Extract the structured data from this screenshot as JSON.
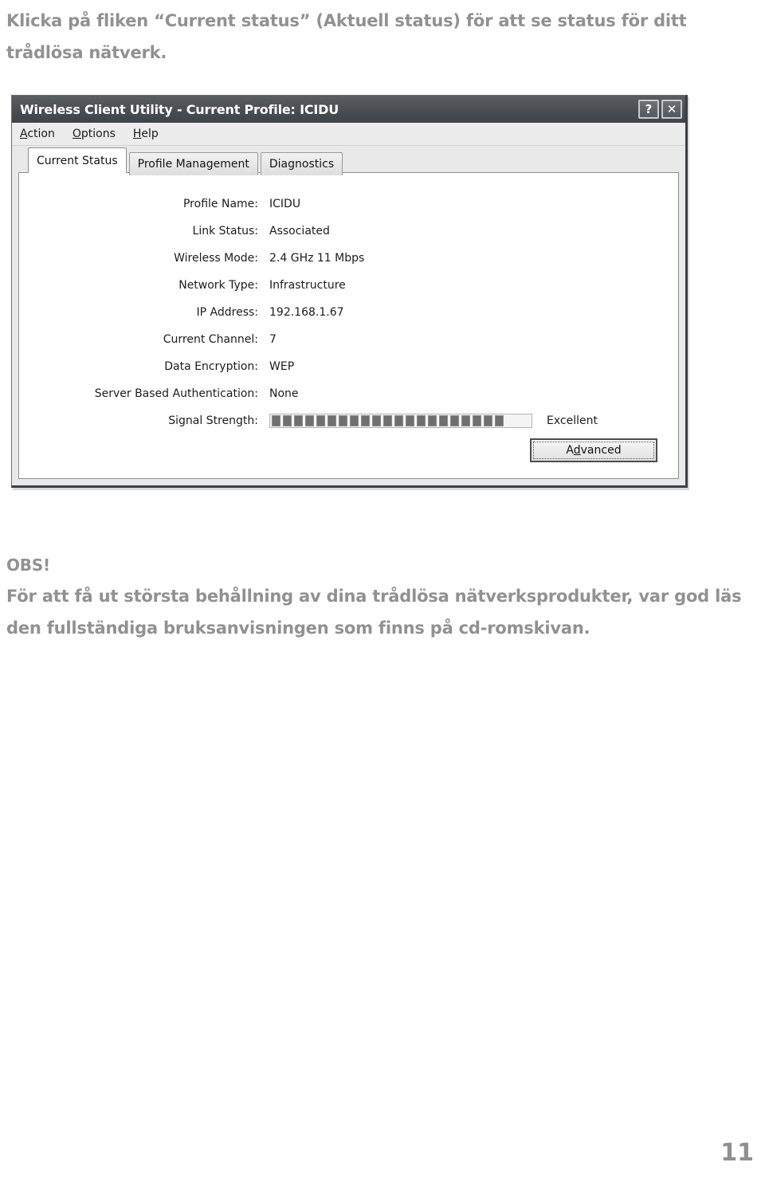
{
  "intro_text": "Klicka på fliken “Current status” (Aktuell status) för att se status för ditt trådlösa nätverk.",
  "dialog": {
    "titlebar": {
      "title": "Wireless Client Utility - Current Profile: ICIDU",
      "help_button": "?",
      "close_button": "✕"
    },
    "menubar": {
      "items": [
        {
          "accel": "A",
          "rest": "ction"
        },
        {
          "accel": "O",
          "rest": "ptions"
        },
        {
          "accel": "H",
          "rest": "elp"
        }
      ]
    },
    "tabs": [
      {
        "label": "Current Status",
        "active": true
      },
      {
        "label": "Profile Management",
        "active": false
      },
      {
        "label": "Diagnostics",
        "active": false
      }
    ],
    "fields": [
      {
        "label": "Profile Name:",
        "value": "ICIDU"
      },
      {
        "label": "Link Status:",
        "value": "Associated"
      },
      {
        "label": "Wireless Mode:",
        "value": "2.4 GHz 11 Mbps"
      },
      {
        "label": "Network Type:",
        "value": "Infrastructure"
      },
      {
        "label": "IP Address:",
        "value": "192.168.1.67"
      },
      {
        "label": "Current Channel:",
        "value": "7"
      },
      {
        "label": "Data Encryption:",
        "value": "WEP"
      },
      {
        "label": "Server Based Authentication:",
        "value": "None"
      }
    ],
    "signal": {
      "label": "Signal Strength:",
      "quality": "Excellent",
      "segments_total": 21,
      "segments_filled": 21
    },
    "advanced_button": {
      "accel": "d",
      "before": "A",
      "after": "vanced"
    }
  },
  "note": {
    "heading": "OBS!",
    "body": "För att få ut största behållning av dina trådlösa nätverksprodukter, var god läs den fullständiga bruksanvisningen som finns på cd-romskivan."
  },
  "page_number": "11"
}
